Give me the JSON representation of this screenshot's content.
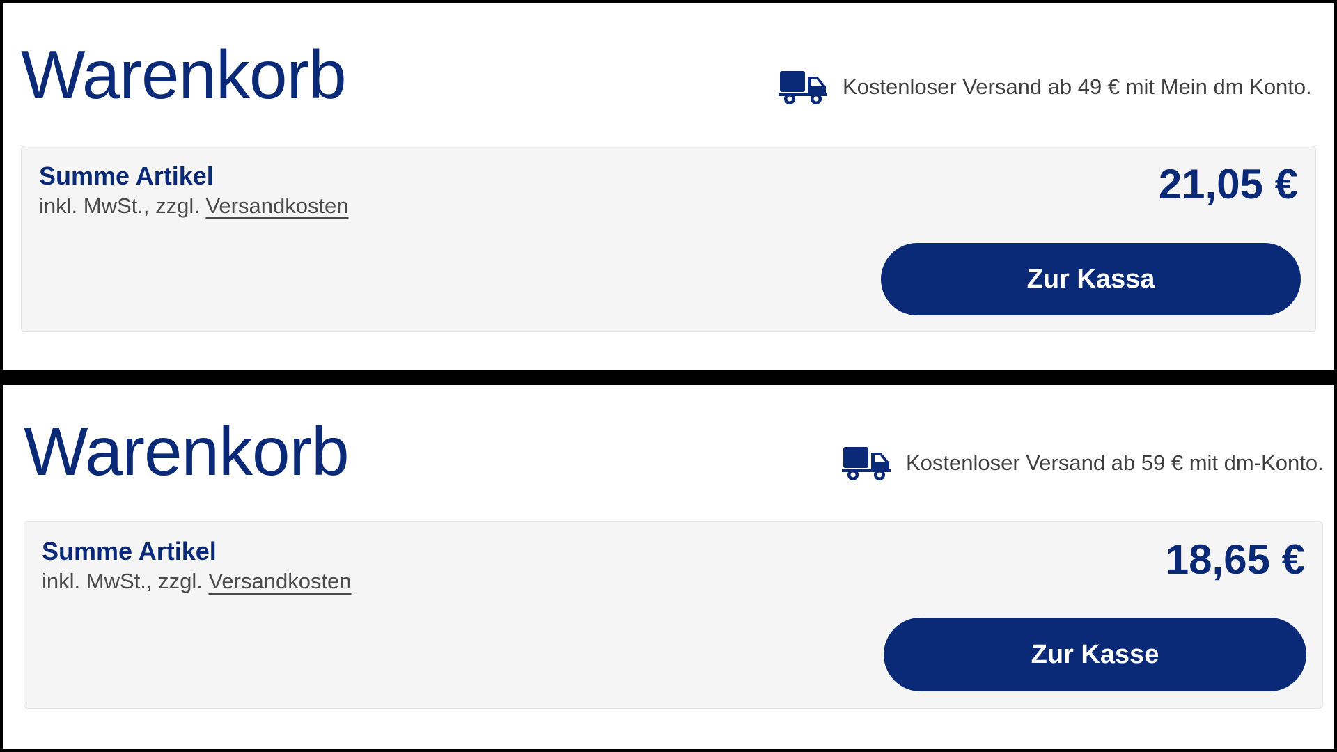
{
  "panels": [
    {
      "title": "Warenkorb",
      "shipping_icon": "truck-icon",
      "shipping_text": "Kostenloser Versand ab 49 € mit Mein dm Konto.",
      "summary_label": "Summe Artikel",
      "tax_text": "inkl. MwSt., zzgl.",
      "shipping_link": "Versandkosten",
      "total": "21,05 €",
      "checkout_label": "Zur Kassa"
    },
    {
      "title": "Warenkorb",
      "shipping_icon": "truck-icon",
      "shipping_text": "Kostenloser Versand ab 59 € mit dm-Konto.",
      "summary_label": "Summe Artikel",
      "tax_text": "inkl. MwSt., zzgl.",
      "shipping_link": "Versandkosten",
      "total": "18,65 €",
      "checkout_label": "Zur Kasse"
    }
  ],
  "colors": {
    "brand_blue": "#0a2a78",
    "card_background": "#f5f5f5",
    "text_gray": "#3f3f3f"
  }
}
